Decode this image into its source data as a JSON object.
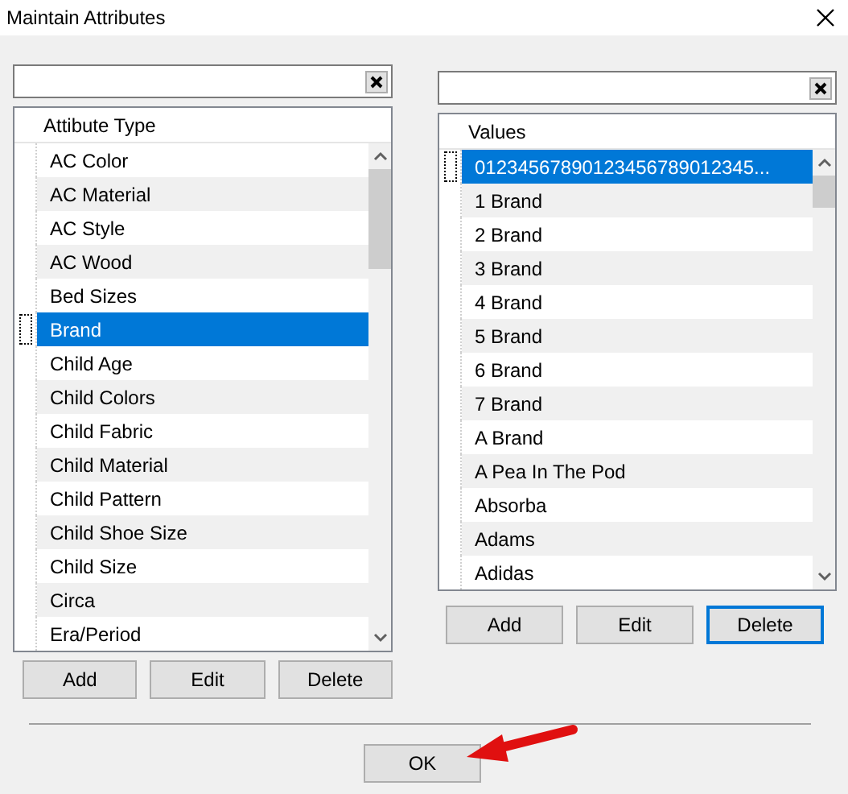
{
  "window": {
    "title": "Maintain Attributes"
  },
  "left": {
    "header": "Attibute Type",
    "items": [
      {
        "label": "AC Color",
        "selected": false
      },
      {
        "label": "AC Material",
        "selected": false
      },
      {
        "label": "AC Style",
        "selected": false
      },
      {
        "label": "AC Wood",
        "selected": false
      },
      {
        "label": "Bed Sizes",
        "selected": false
      },
      {
        "label": "Brand",
        "selected": true
      },
      {
        "label": "Child Age",
        "selected": false
      },
      {
        "label": "Child Colors",
        "selected": false
      },
      {
        "label": "Child Fabric",
        "selected": false
      },
      {
        "label": "Child Material",
        "selected": false
      },
      {
        "label": "Child Pattern",
        "selected": false
      },
      {
        "label": "Child Shoe Size",
        "selected": false
      },
      {
        "label": "Child Size",
        "selected": false
      },
      {
        "label": "Circa",
        "selected": false
      },
      {
        "label": "Era/Period",
        "selected": false
      }
    ],
    "buttons": [
      {
        "label": "Add",
        "focused": false
      },
      {
        "label": "Edit",
        "focused": false
      },
      {
        "label": "Delete",
        "focused": false
      }
    ]
  },
  "right": {
    "header": "Values",
    "items": [
      {
        "label": "01234567890123456789012345...",
        "selected": true
      },
      {
        "label": "1 Brand",
        "selected": false
      },
      {
        "label": "2 Brand",
        "selected": false
      },
      {
        "label": "3 Brand",
        "selected": false
      },
      {
        "label": "4 Brand",
        "selected": false
      },
      {
        "label": "5 Brand",
        "selected": false
      },
      {
        "label": "6 Brand",
        "selected": false
      },
      {
        "label": "7 Brand",
        "selected": false
      },
      {
        "label": "A Brand",
        "selected": false
      },
      {
        "label": "A Pea In The Pod",
        "selected": false
      },
      {
        "label": "Absorba",
        "selected": false
      },
      {
        "label": "Adams",
        "selected": false
      },
      {
        "label": "Adidas",
        "selected": false
      }
    ],
    "buttons": [
      {
        "label": "Add",
        "focused": false
      },
      {
        "label": "Edit",
        "focused": false
      },
      {
        "label": "Delete",
        "focused": true
      }
    ]
  },
  "ok_button": {
    "label": "OK"
  }
}
